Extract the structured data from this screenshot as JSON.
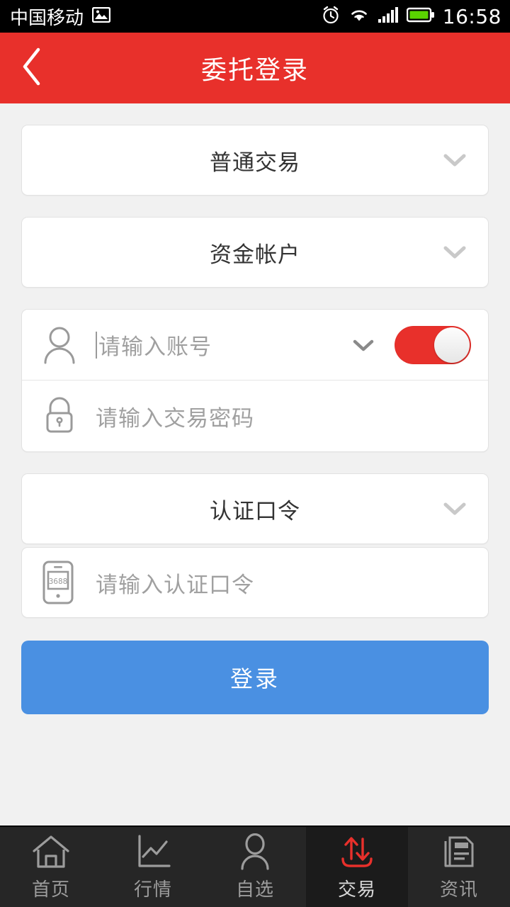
{
  "status_bar": {
    "carrier": "中国移动",
    "time": "16:58",
    "icons": [
      "image-icon",
      "alarm-icon",
      "wifi-icon",
      "signal-icon",
      "battery-icon"
    ],
    "battery_color": "#5ad400"
  },
  "header": {
    "title": "委托登录",
    "back_icon": "chevron-left-icon",
    "background_color": "#e8302b"
  },
  "form": {
    "trade_type": {
      "value": "普通交易",
      "chevron": "chevron-down-icon"
    },
    "account_type": {
      "value": "资金帐户",
      "chevron": "chevron-down-icon"
    },
    "account": {
      "icon": "person-icon",
      "value": "",
      "placeholder": "请输入账号",
      "chevron": "chevron-down-icon",
      "toggle_on": true,
      "toggle_color": "#e8302b"
    },
    "password": {
      "icon": "lock-icon",
      "value": "",
      "placeholder": "请输入交易密码"
    },
    "token_type": {
      "value": "认证口令",
      "chevron": "chevron-down-icon"
    },
    "token": {
      "icon": "token-device-icon",
      "icon_display_text": "3688",
      "value": "",
      "placeholder": "请输入认证口令"
    },
    "login_button": {
      "label": "登录",
      "color": "#4a90e2"
    }
  },
  "tabbar": {
    "items": [
      {
        "label": "首页",
        "icon": "home-icon",
        "active": false
      },
      {
        "label": "行情",
        "icon": "chart-icon",
        "active": false
      },
      {
        "label": "自选",
        "icon": "person-icon",
        "active": false
      },
      {
        "label": "交易",
        "icon": "trade-arrows-icon",
        "active": true
      },
      {
        "label": "资讯",
        "icon": "news-icon",
        "active": false
      }
    ],
    "active_color": "#e8302b"
  }
}
